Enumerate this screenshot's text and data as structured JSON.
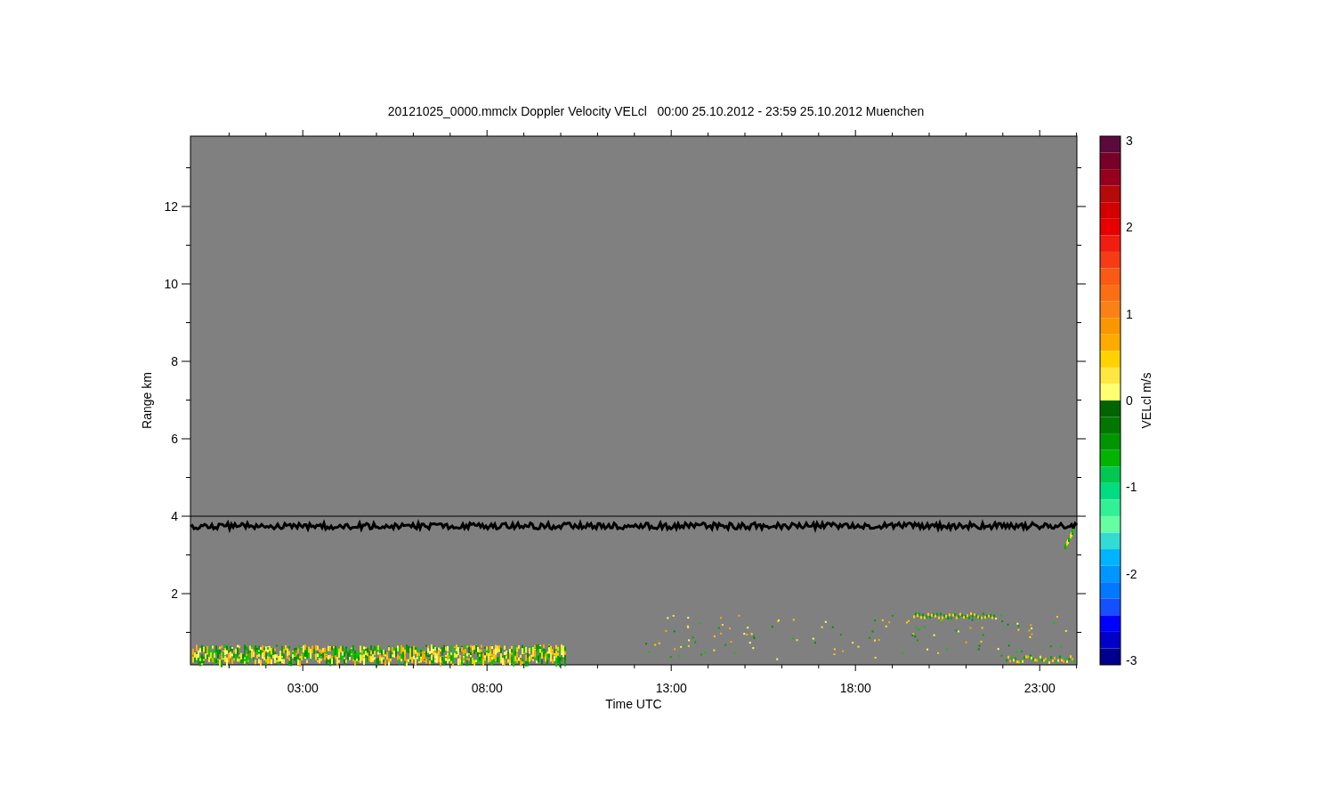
{
  "plot": {
    "title": "20121025_0000.mmclx Doppler Velocity VELcl   00:00 25.10.2012 - 23:59 25.10.2012 Muenchen",
    "xlabel": "Time UTC",
    "ylabel": "Range km",
    "xticks": [
      "03:00",
      "08:00",
      "13:00",
      "18:00",
      "23:00"
    ],
    "yticks": [
      "12",
      "10",
      "8",
      "6",
      "4",
      "2"
    ],
    "colorbar": {
      "label": "VELcl m/s",
      "ticks": [
        "3",
        "2",
        "1",
        "0",
        "-1",
        "-2",
        "-3"
      ],
      "segments": [
        {
          "color": "#5c0a3c"
        },
        {
          "color": "#780028"
        },
        {
          "color": "#96001e"
        },
        {
          "color": "#b40a0a"
        },
        {
          "color": "#d20000"
        },
        {
          "color": "#e60000"
        },
        {
          "color": "#f01e10"
        },
        {
          "color": "#f53c14"
        },
        {
          "color": "#fa5a14"
        },
        {
          "color": "#fa6e14"
        },
        {
          "color": "#fa8214"
        },
        {
          "color": "#fa9600"
        },
        {
          "color": "#ffaa00"
        },
        {
          "color": "#ffd200"
        },
        {
          "color": "#ffe640"
        },
        {
          "color": "#ffff70"
        },
        {
          "color": "#006400"
        },
        {
          "color": "#007800"
        },
        {
          "color": "#009600"
        },
        {
          "color": "#00b400"
        },
        {
          "color": "#00c850"
        },
        {
          "color": "#00dc82"
        },
        {
          "color": "#32f096"
        },
        {
          "color": "#64ffa0"
        },
        {
          "color": "#32dcd2"
        },
        {
          "color": "#00b4ff"
        },
        {
          "color": "#0096ff"
        },
        {
          "color": "#0078ff"
        },
        {
          "color": "#1450ff"
        },
        {
          "color": "#0000ff"
        },
        {
          "color": "#0000c8"
        },
        {
          "color": "#00008c"
        }
      ]
    }
  }
}
